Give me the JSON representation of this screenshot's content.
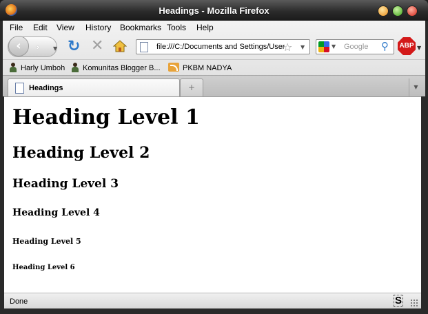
{
  "window": {
    "title": "Headings - Mozilla Firefox"
  },
  "menu": [
    "File",
    "Edit",
    "View",
    "History",
    "Bookmarks",
    "Tools",
    "Help"
  ],
  "navigation": {
    "url": "file:///C:/Documents and Settings/User",
    "search_placeholder": "Google"
  },
  "bookmarks": [
    "Harly Umboh",
    "Komunitas Blogger B...",
    "PKBM NADYA"
  ],
  "tabs": [
    {
      "label": "Headings"
    }
  ],
  "content": {
    "h1": "Heading Level 1",
    "h2": "Heading Level 2",
    "h3": "Heading Level 3",
    "h4": "Heading Level 4",
    "h5": "Heading Level 5",
    "h6": "Heading Level 6"
  },
  "status": {
    "text": "Done",
    "indicator": "S"
  },
  "addons": {
    "adblock_label": "ABP"
  },
  "colors": {
    "abp_red": "#d31919",
    "reload_blue": "#2e79c9",
    "titlebar_dark": "#2b2b2b"
  }
}
